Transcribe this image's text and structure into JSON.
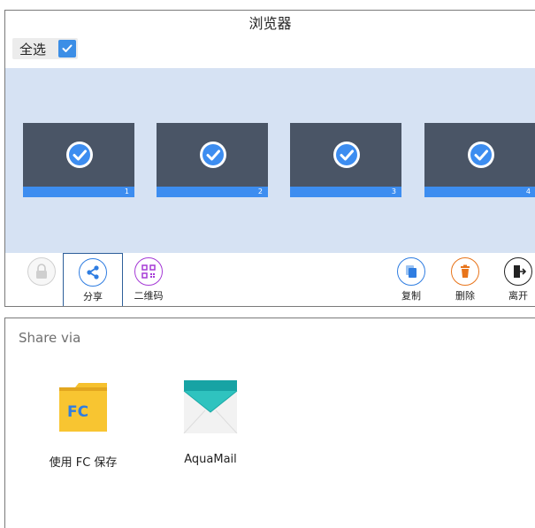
{
  "browser": {
    "title": "浏览器",
    "select_all_label": "全选",
    "select_all_checked": true,
    "thumbnails": [
      {
        "number": "1",
        "selected": true
      },
      {
        "number": "2",
        "selected": true
      },
      {
        "number": "3",
        "selected": true
      },
      {
        "number": "4",
        "selected": true
      }
    ],
    "toolbar": {
      "lock_label": "",
      "share_label": "分享",
      "qrcode_label": "二维码",
      "copy_label": "复制",
      "delete_label": "删除",
      "exit_label": "离开"
    }
  },
  "share_sheet": {
    "title": "Share via",
    "apps": [
      {
        "label": "使用 FC 保存",
        "icon": "fc-folder-icon"
      },
      {
        "label": "AquaMail",
        "icon": "aquamail-icon"
      }
    ]
  },
  "colors": {
    "accent_blue": "#3d8df0",
    "thumb_bg": "#4a5566",
    "strip_bg": "#d6e2f3",
    "share_blue": "#2f7de1",
    "qr_purple": "#a53ad6",
    "copy_blue": "#2f7de1",
    "delete_orange": "#e8741a",
    "fc_yellow": "#f6c12e",
    "aqua_teal": "#1fb6b3"
  }
}
